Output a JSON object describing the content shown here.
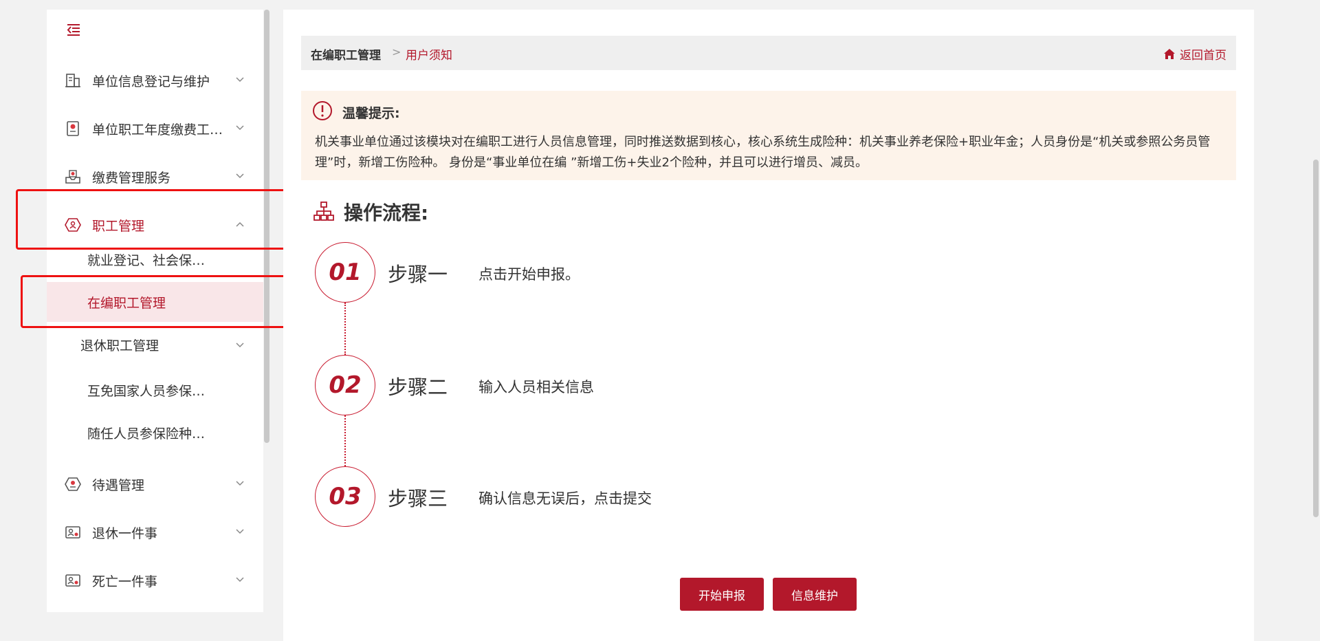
{
  "sidebar": {
    "items": [
      {
        "label": "单位信息登记与维护",
        "icon": "building-icon"
      },
      {
        "label": "单位职工年度缴费工…",
        "icon": "document-badge-icon"
      },
      {
        "label": "缴费管理服务",
        "icon": "payment-tray-icon"
      },
      {
        "label": "职工管理",
        "icon": "staff-hexagon-icon"
      },
      {
        "label": "待遇管理",
        "icon": "benefit-hexagon-icon"
      },
      {
        "label": "退休一件事",
        "icon": "id-card-icon"
      },
      {
        "label": "死亡一件事",
        "icon": "id-card-icon"
      }
    ],
    "sub_items": [
      {
        "label": "就业登记、社会保…"
      },
      {
        "label": "在编职工管理"
      },
      {
        "label": "退休职工管理"
      },
      {
        "label": "互免国家人员参保…"
      },
      {
        "label": "随任人员参保险种…"
      }
    ]
  },
  "breadcrumb": {
    "root": "在编职工管理",
    "separator": ">",
    "current": "用户须知",
    "home_label": "返回首页"
  },
  "notice": {
    "title": "温馨提示:",
    "text": "机关事业单位通过该模块对在编职工进行人员信息管理，同时推送数据到核心，核心系统生成险种：机关事业养老保险+职业年金；人员身份是“机关或参照公务员管理”时，新增工伤险种。 身份是“事业单位在编 ”新增工伤+失业2个险种，并且可以进行增员、减员。"
  },
  "flow": {
    "title": "操作流程:",
    "steps": [
      {
        "number": "01",
        "name": "步骤一",
        "desc": "点击开始申报。"
      },
      {
        "number": "02",
        "name": "步骤二",
        "desc": "输入人员相关信息"
      },
      {
        "number": "03",
        "name": "步骤三",
        "desc": "确认信息无误后，点击提交"
      }
    ]
  },
  "buttons": {
    "start": "开始申报",
    "maintain": "信息维护"
  },
  "colors": {
    "accent": "#b3182b",
    "highlight_box": "#ee1111",
    "selected_bg": "#f9e6e8",
    "notice_bg": "#fdf3ea"
  }
}
